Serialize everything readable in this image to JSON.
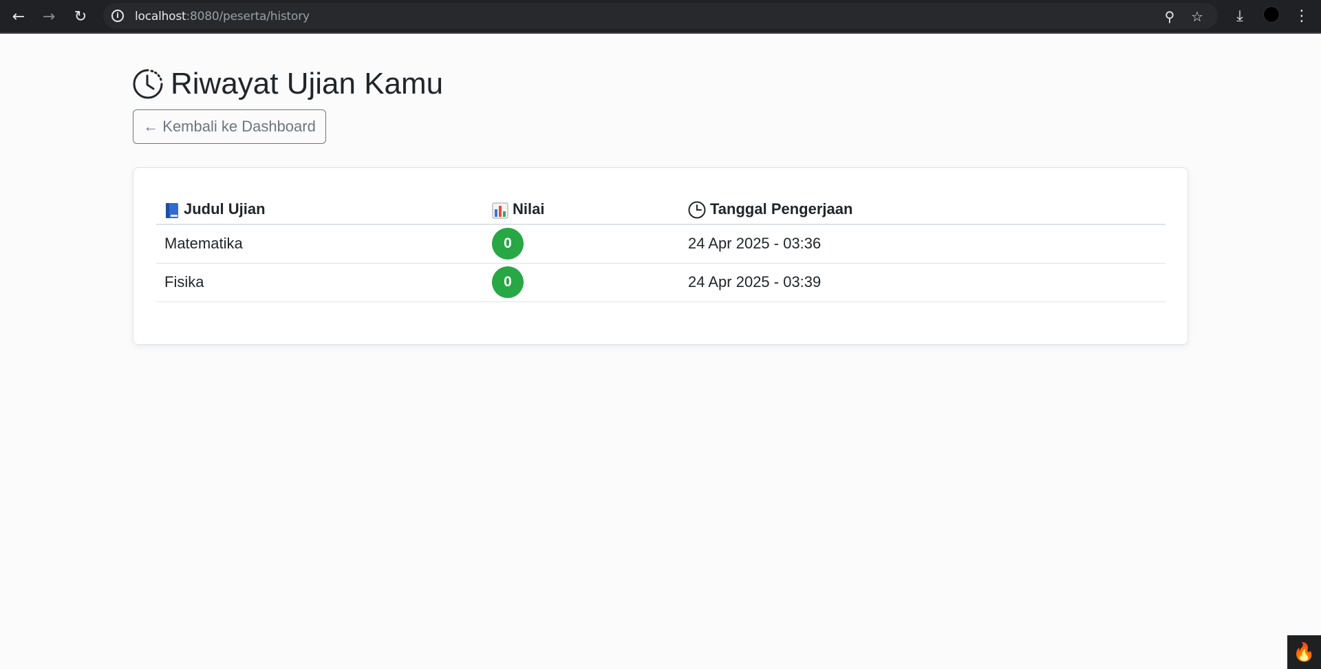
{
  "browser": {
    "url_host": "localhost",
    "url_rest": ":8080/peserta/history"
  },
  "page": {
    "title": "Riwayat Ujian Kamu",
    "back_button": "← Kembali ke Dashboard"
  },
  "table": {
    "headers": {
      "title": "Judul Ujian",
      "score": "Nilai",
      "date": "Tanggal Pengerjaan"
    },
    "rows": [
      {
        "exam": "Matematika",
        "score": "0",
        "date": "24 Apr 2025 - 03:36"
      },
      {
        "exam": "Fisika",
        "score": "0",
        "date": "24 Apr 2025 - 03:39"
      }
    ]
  },
  "colors": {
    "score_badge": "#28a745",
    "button_outline": "#6c757d"
  }
}
